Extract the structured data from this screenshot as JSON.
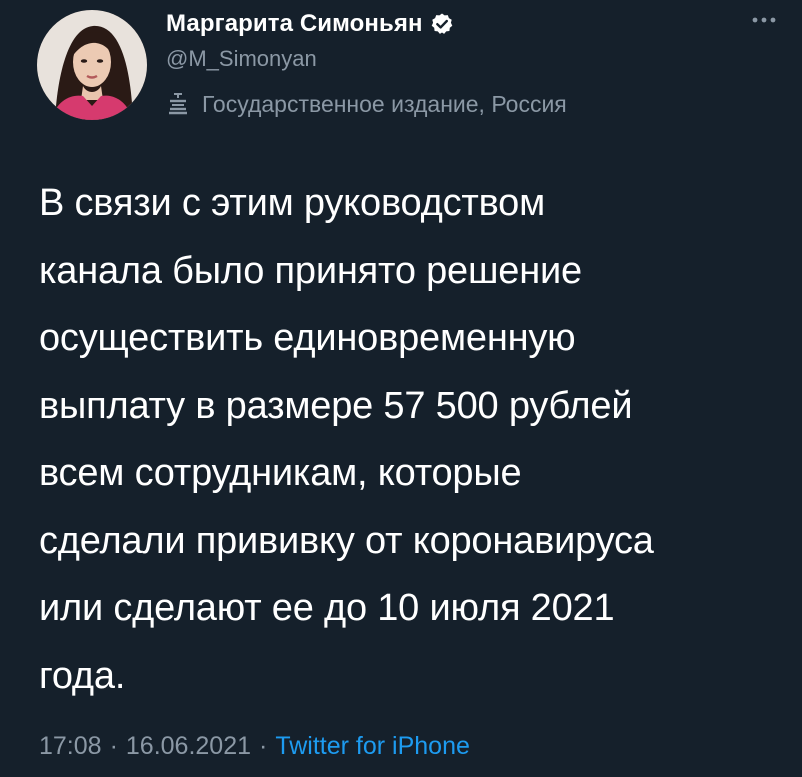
{
  "author": {
    "display_name": "Маргарита Симоньян",
    "handle": "@M_Simonyan",
    "verified": true,
    "label": "Государственное издание, Россия",
    "avatar_icon": "profile-photo"
  },
  "menu": {
    "more_icon": "more-icon"
  },
  "tweet": {
    "text": "В связи с этим руководством\nканала было принято решение\nосуществить единовременную\nвыплату в размере 57 500 рублей\nвсем сотрудникам, которые\nсделали прививку от коронавируса\nили сделают ее до 10 июля 2021\nгода.",
    "time": "17:08",
    "date": "16.06.2021",
    "separator": "·",
    "source": "Twitter for iPhone"
  },
  "colors": {
    "background": "#15202b",
    "primary_text": "#ffffff",
    "secondary_text": "#8b98a5",
    "link": "#1d9bf0"
  }
}
